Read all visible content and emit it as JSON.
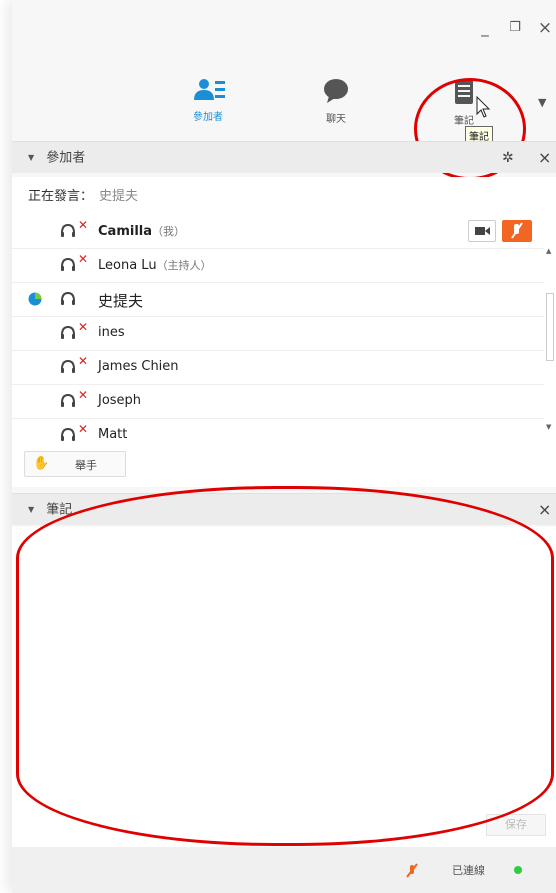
{
  "window": {
    "controls": {
      "minimize": "_",
      "restore": "❐",
      "close": "×"
    }
  },
  "toolbar": {
    "items": [
      {
        "label": "參加者",
        "icon": "participants-icon",
        "active": true
      },
      {
        "label": "聊天",
        "icon": "chat-icon",
        "active": false
      },
      {
        "label": "筆記",
        "icon": "notes-icon",
        "active": false
      }
    ],
    "tooltip": "筆記",
    "more": "▼"
  },
  "participants_panel": {
    "title": "參加者",
    "speaking_label": "正在發言：",
    "speaking_name": "史提夫",
    "rows": [
      {
        "name": "Camilla",
        "tag": "（我）",
        "muted": true
      },
      {
        "name": "Leona Lu",
        "tag": "（主持人）",
        "muted": true
      },
      {
        "name": "史提夫",
        "tag": "",
        "muted": false
      },
      {
        "name": "ines",
        "tag": "",
        "muted": true
      },
      {
        "name": "James Chien",
        "tag": "",
        "muted": true
      },
      {
        "name": "Joseph",
        "tag": "",
        "muted": true
      },
      {
        "name": "Matt",
        "tag": "",
        "muted": true
      }
    ],
    "raise_hand_label": "舉手"
  },
  "notes_panel": {
    "title": "筆記",
    "save_label": "保存"
  },
  "statusbar": {
    "status_text": "已連線"
  },
  "colors": {
    "accent": "#1a8fd8",
    "mute_red": "#e02020",
    "annotation_red": "#e00000",
    "connected_green": "#2ecc40",
    "mic_orange": "#f26522"
  }
}
